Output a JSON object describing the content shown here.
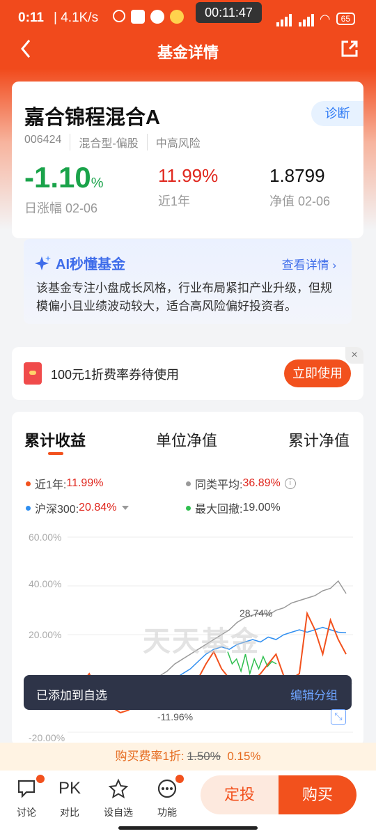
{
  "status": {
    "time": "0:11",
    "speed": "4.1K/s",
    "timer": "00:11:47",
    "battery": "65"
  },
  "nav": {
    "title": "基金详情"
  },
  "fund": {
    "name": "嘉合锦程混合A",
    "diagnose": "诊断",
    "code": "006424",
    "type": "混合型-偏股",
    "risk": "中高风险",
    "daily_change": "-1.10",
    "daily_unit": "%",
    "daily_label": "日涨幅 02-06",
    "year_return": "11.99%",
    "year_label": "近1年",
    "nav_value": "1.8799",
    "nav_label": "净值 02-06"
  },
  "ai": {
    "title": "AI秒懂基金",
    "more": "查看详情",
    "text": "该基金专注小盘成长风格，行业布局紧扣产业升级，但规模偏小且业绩波动较大，适合高风险偏好投资者。"
  },
  "coupon": {
    "text": "100元1折费率券待使用",
    "button": "立即使用",
    "close": "×"
  },
  "chart": {
    "tabs": [
      "累计收益",
      "单位净值",
      "累计净值"
    ],
    "legend": [
      {
        "label": "近1年:",
        "value": "11.99%",
        "color": "#f2511d"
      },
      {
        "label": "同类平均:",
        "value": "36.89%",
        "color": "#999999"
      },
      {
        "label": "沪深300:",
        "value": "20.84%",
        "color": "#2f8ef0"
      },
      {
        "label": "最大回撤:",
        "value": "19.00%",
        "color": "#2fbf4f"
      }
    ],
    "y_ticks": [
      "60.00%",
      "40.00%",
      "20.00%",
      "-20.00%"
    ],
    "annotation_max": "28.74%",
    "annotation_min": "-11.96%",
    "watermark": "天天基金"
  },
  "chart_data": {
    "type": "line",
    "ylim": [
      -20,
      60
    ],
    "yticks": [
      "60.00%",
      "40.00%",
      "20.00%",
      "-20.00%"
    ],
    "series": [
      {
        "name": "近1年",
        "color": "#f2511d",
        "values": [
          0,
          4,
          -2,
          -8,
          -10,
          -12,
          -11,
          -9,
          -10,
          -7,
          -8,
          -5,
          -3,
          -4,
          -1,
          2,
          8,
          13,
          6,
          2,
          -1,
          2,
          1,
          4,
          8,
          12,
          3,
          2,
          4,
          28.7,
          22,
          12,
          26,
          18,
          12
        ]
      },
      {
        "name": "同类平均",
        "color": "#999999",
        "values": [
          0,
          3,
          1,
          0,
          -2,
          -1,
          0,
          1,
          2,
          2,
          3,
          5,
          8,
          10,
          12,
          14,
          16,
          18,
          20,
          22,
          25,
          27,
          28,
          29,
          28,
          30,
          31,
          33,
          34,
          35,
          36,
          38,
          39,
          42,
          36.9
        ]
      },
      {
        "name": "沪深300",
        "color": "#2f8ef0",
        "values": [
          0,
          2,
          0,
          -3,
          -5,
          -6,
          -5,
          -4,
          -3,
          -3,
          -2,
          -1,
          2,
          4,
          6,
          9,
          12,
          14,
          15,
          14,
          16,
          17,
          18,
          17,
          19,
          18,
          20,
          21,
          22,
          21,
          22,
          23,
          22,
          21,
          20.8
        ]
      },
      {
        "name": "最大回撤",
        "color": "#2fbf4f",
        "values": [
          13,
          8,
          10,
          5,
          12,
          4,
          10,
          6,
          11,
          7,
          9,
          8
        ]
      }
    ]
  },
  "toast": {
    "message": "已添加到自选",
    "action": "编辑分组"
  },
  "fee": {
    "label": "购买费率1折:",
    "old": "1.50%",
    "new": "0.15%"
  },
  "bottom": {
    "discuss": "讨论",
    "compare_icon": "PK",
    "compare": "对比",
    "watch": "设自选",
    "more": "功能",
    "fixed": "定投",
    "buy": "购买"
  }
}
